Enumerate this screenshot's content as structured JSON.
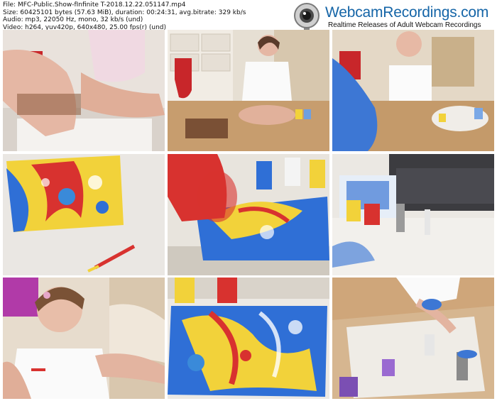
{
  "info": {
    "file": "File: MFC-Public.Show-fInfinite T-2018.12.22.051147.mp4",
    "size": "Size: 60425101 bytes (57.63 MiB), duration: 00:24:31, avg.bitrate: 329 kb/s",
    "audio": "Audio: mp3, 22050 Hz, mono, 32 kb/s (und)",
    "video": "Video: h264, yuv420p, 640x480, 25.00 fps(r) (und)"
  },
  "logo": {
    "title": "WebcamRecordings.com",
    "subtitle": "Realtime Releases of Adult Webcam Recordings"
  },
  "thumbnails": [
    {
      "scene": "legs-closeup-stocking"
    },
    {
      "scene": "girl-sitting-floor-stocking"
    },
    {
      "scene": "girl-kneeling-blue-blur"
    },
    {
      "scene": "marbled-canvas-closeup"
    },
    {
      "scene": "pouring-paint-canvas"
    },
    {
      "scene": "floor-cups-sofa"
    },
    {
      "scene": "girl-selfie-closeup"
    },
    {
      "scene": "finished-canvas-colors"
    },
    {
      "scene": "floor-overhead-cups"
    }
  ],
  "colors": {
    "logo_blue": "#1565a7",
    "paint_blue": "#2f6fd6",
    "paint_yellow": "#f2d23a",
    "paint_red": "#d8322f",
    "floor_wood": "#b98a5a"
  }
}
